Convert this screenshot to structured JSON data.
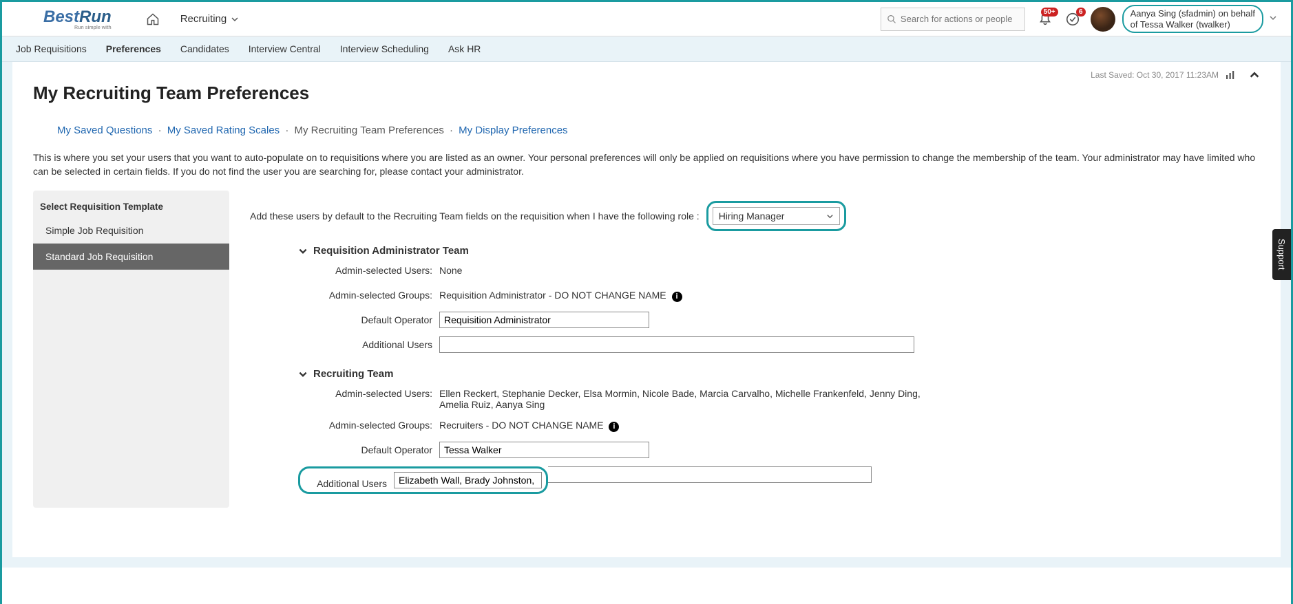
{
  "header": {
    "brand_best": "Best",
    "brand_run": "Run",
    "brand_tagline": "Run simple with ",
    "nav_module": "Recruiting",
    "search_placeholder": "Search for actions or people",
    "notif_badge": "50+",
    "todos_badge": "6",
    "user_line1": "Aanya Sing (sfadmin) on behalf",
    "user_line2": "of Tessa Walker (twalker)"
  },
  "subnav": {
    "items": [
      "Job Requisitions",
      "Preferences",
      "Candidates",
      "Interview Central",
      "Interview Scheduling",
      "Ask HR"
    ],
    "active_index": 1
  },
  "page": {
    "last_saved": "Last Saved: Oct 30, 2017 11:23AM",
    "title": "My Recruiting Team Preferences",
    "breadcrumb": {
      "items": [
        "My Saved Questions",
        "My Saved Rating Scales",
        "My Recruiting Team Preferences",
        "My Display Preferences"
      ],
      "current_index": 2
    },
    "intro": "This is where you set your users that you want to auto-populate on to requisitions where you are listed as an owner. Your personal preferences will only be applied on requisitions where you have permission to change the membership of the team. Your administrator may have limited who can be selected in certain fields. If you do not find the user you are searching for, please contact your administrator."
  },
  "sidebar": {
    "title": "Select Requisition Template",
    "items": [
      "Simple Job Requisition",
      "Standard Job Requisition"
    ],
    "selected_index": 1
  },
  "main": {
    "role_prompt": "Add these users by default to the Recruiting Team fields on the requisition when I have the following role :",
    "role_value": "Hiring Manager",
    "sections": [
      {
        "title": "Requisition Administrator Team",
        "fields": {
          "admin_users_label": "Admin-selected Users:",
          "admin_users_value": "None",
          "admin_groups_label": "Admin-selected Groups:",
          "admin_groups_value": "Requisition Administrator - DO NOT CHANGE NAME",
          "default_op_label": "Default Operator",
          "default_op_value": "Requisition Administrator",
          "additional_label": "Additional Users",
          "additional_value": ""
        }
      },
      {
        "title": "Recruiting Team",
        "fields": {
          "admin_users_label": "Admin-selected Users:",
          "admin_users_value": "Ellen Reckert, Stephanie Decker, Elsa Mormin, Nicole Bade, Marcia Carvalho, Michelle Frankenfeld, Jenny Ding, Amelia Ruiz, Aanya Sing",
          "admin_groups_label": "Admin-selected Groups:",
          "admin_groups_value": "Recruiters - DO NOT CHANGE NAME",
          "default_op_label": "Default Operator",
          "default_op_value": "Tessa Walker",
          "additional_label": "Additional Users",
          "additional_value": "Elizabeth Wall, Brady Johnston,"
        }
      }
    ]
  },
  "support": "Support"
}
